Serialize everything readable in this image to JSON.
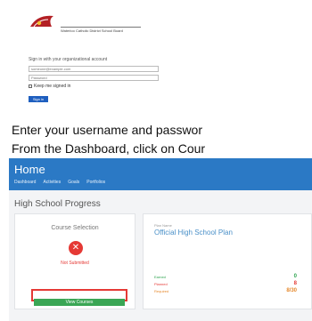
{
  "login": {
    "logo_text": "Waterloo Catholic District School Board",
    "title": "Sign in with your organizational account",
    "username_placeholder": "someone@example.com",
    "password_placeholder": "Password",
    "keep_signed_in": "Keep me signed in",
    "signin_button": "Sign in"
  },
  "instructions": {
    "line1": "Enter your username and passwor",
    "line2": "From the Dashboard, click on Cour"
  },
  "app": {
    "title": "Home",
    "nav": [
      "Dashboard",
      "Activities",
      "Goals",
      "Portfolios"
    ],
    "section_title": "High School Progress",
    "course_selection": {
      "title": "Course Selection",
      "status": "Not Submitted",
      "button": "View Courses"
    },
    "plan": {
      "label": "Plan Name",
      "name": "Official High School Plan",
      "credits": [
        {
          "label": "Earned",
          "value": "0"
        },
        {
          "label": "Planned",
          "value": "8"
        },
        {
          "label": "Required",
          "value": "8/30"
        }
      ]
    },
    "colors": {
      "accent": "#2b79c5",
      "success": "#3aa655",
      "danger": "#e53935",
      "warning": "#e68a2e"
    }
  }
}
